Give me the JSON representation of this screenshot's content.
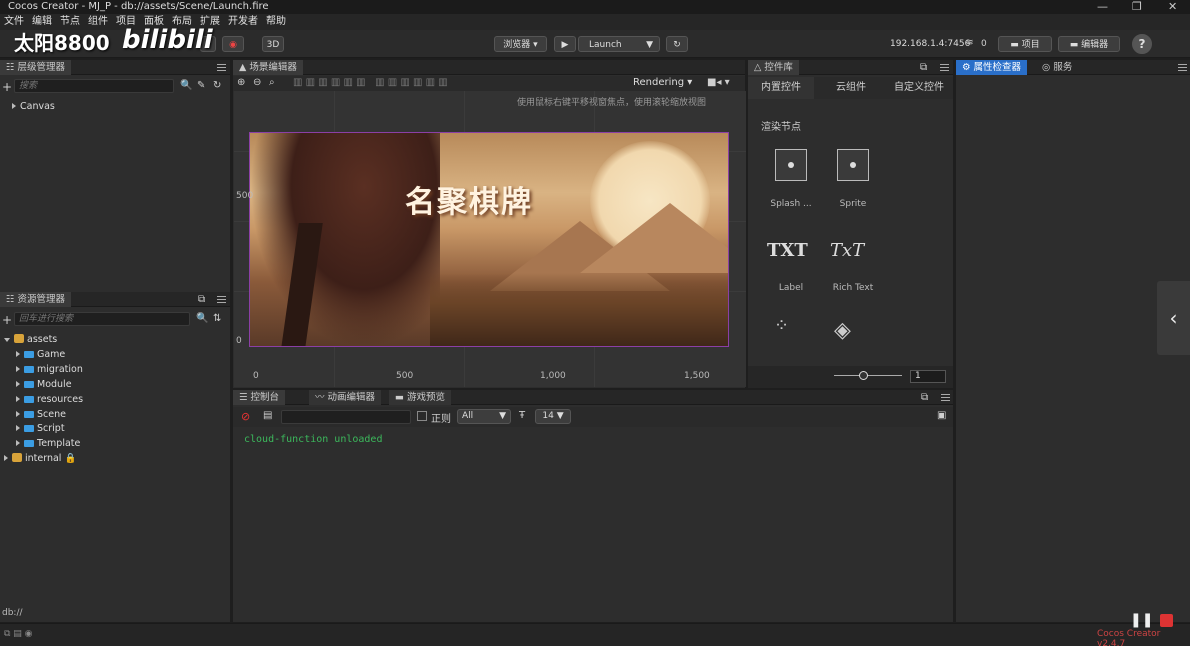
{
  "window": {
    "title": "Cocos Creator - MJ_P - db://assets/Scene/Launch.fire"
  },
  "watermark": {
    "text": "太阳8800",
    "site": "bilibili"
  },
  "menu": [
    "文件",
    "编辑",
    "节点",
    "组件",
    "项目",
    "面板",
    "布局",
    "扩展",
    "开发者",
    "帮助"
  ],
  "toolbar": {
    "mode_3d": "3D",
    "browser": "浏览器 ▾",
    "launch": "Launch",
    "ip": "192.168.1.4:7456",
    "wifi_count": "0",
    "project_btn": "项目",
    "editor_btn": "编辑器",
    "help": "?"
  },
  "hierarchy": {
    "title": "层级管理器",
    "search_placeholder": "搜索",
    "items": [
      "Canvas"
    ]
  },
  "assets": {
    "title": "资源管理器",
    "search_placeholder": "回车进行搜索",
    "root": "assets",
    "folders": [
      "Game",
      "migration",
      "Module",
      "resources",
      "Scene",
      "Script",
      "Template"
    ],
    "internal": "internal"
  },
  "scene": {
    "title": "场景编辑器",
    "rendering": "Rendering",
    "hint": "使用鼠标右键平移视窗焦点，使用滚轮缩放视图",
    "logo": "名聚棋牌",
    "y_labels": [
      "500",
      "0"
    ],
    "x_labels": [
      "0",
      "500",
      "1,000",
      "1,500"
    ]
  },
  "widgets": {
    "title": "控件库",
    "tabs": [
      "内置控件",
      "云组件",
      "自定义控件"
    ],
    "section": "渲染节点",
    "items": [
      "Splash ...",
      "Sprite",
      "Label",
      "Rich Text"
    ],
    "label_glyph": "TXT",
    "richtext_glyph": "TxT",
    "zoom_value": "1"
  },
  "inspector": {
    "tabs": [
      "属性检查器",
      "服务"
    ]
  },
  "console": {
    "tabs": [
      "控制台",
      "动画编辑器",
      "游戏预览"
    ],
    "regex_label": "正则",
    "filter": "All",
    "font_size": "14",
    "lines": [
      "cloud-function unloaded"
    ]
  },
  "status": {
    "path": "db://",
    "version": "Cocos Creator v2.4.7"
  }
}
